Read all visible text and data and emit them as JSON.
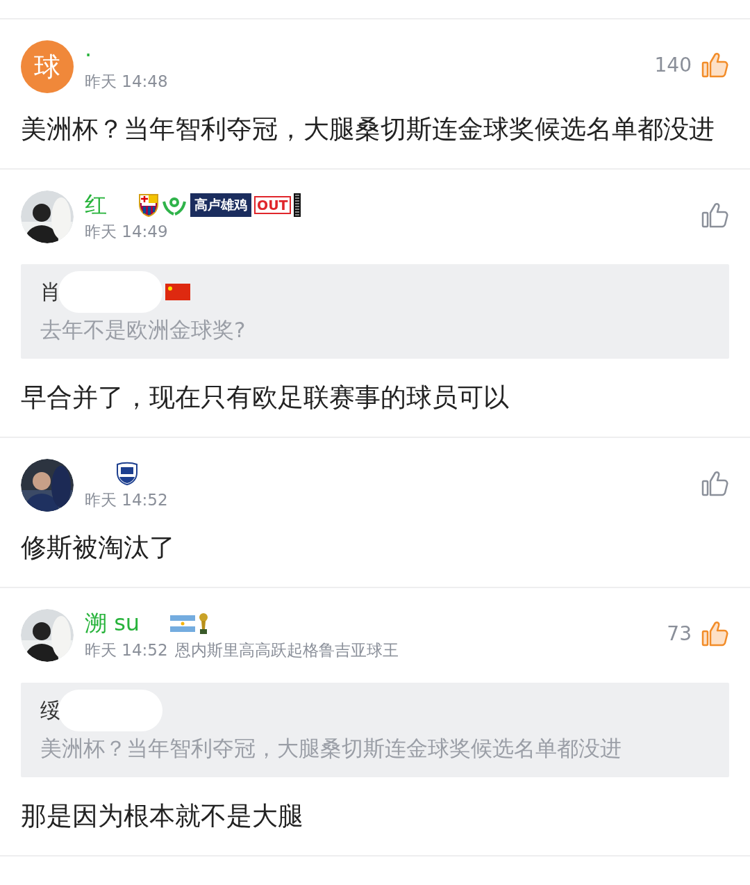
{
  "comments": [
    {
      "avatar": {
        "kind": "letter",
        "letter": "球"
      },
      "name": "·",
      "time": "昨天 14:48",
      "likes": "140",
      "liked": true,
      "text": "美洲杯？当年智利夺冠，大腿桑切斯连金球奖候选名单都没进"
    },
    {
      "avatar": {
        "kind": "picture"
      },
      "name": "红",
      "badges": [
        {
          "kind": "crest"
        },
        {
          "kind": "hands"
        },
        {
          "kind": "label",
          "text": "高卢雄鸡"
        },
        {
          "kind": "stamp",
          "text": "OUT"
        },
        {
          "kind": "stripe"
        }
      ],
      "time": "昨天 14:49",
      "liked": false,
      "quote": {
        "author": "肖",
        "redacted": true,
        "badges": [
          {
            "kind": "flag-cn"
          }
        ],
        "text": "去年不是欧洲金球奖?"
      },
      "text": "早合并了，现在只有欧足联赛事的球员可以"
    },
    {
      "avatar": {
        "kind": "picture"
      },
      "badges": [
        {
          "kind": "shield"
        }
      ],
      "time": "昨天 14:52",
      "liked": false,
      "text": "修斯被淘汰了"
    },
    {
      "avatar": {
        "kind": "picture"
      },
      "name": "溯 su",
      "badges": [
        {
          "kind": "flag-ar"
        },
        {
          "kind": "trophy"
        }
      ],
      "time": "昨天 14:52",
      "extra": "恩内斯里高高跃起格鲁吉亚球王",
      "likes": "73",
      "liked": true,
      "quote": {
        "author": "绥",
        "redacted": true,
        "text": "美洲杯？当年智利夺冠，大腿桑切斯连金球奖候选名单都没进"
      },
      "text": "那是因为根本就不是大腿"
    }
  ]
}
